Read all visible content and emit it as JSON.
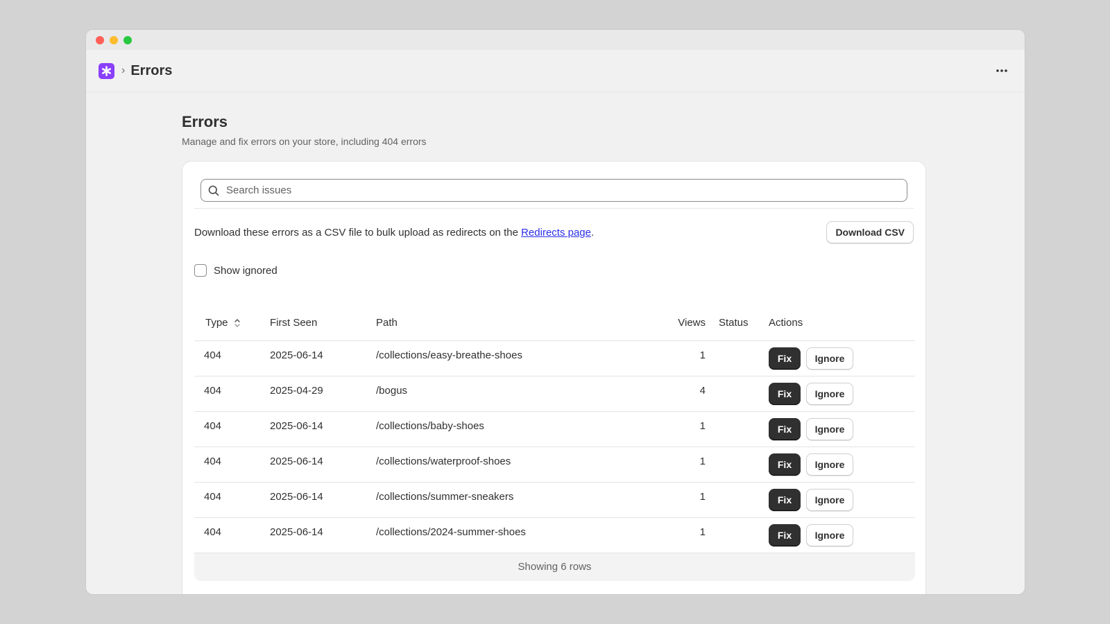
{
  "window": {
    "title": "Errors"
  },
  "appbar": {
    "logo_icon": "asterisk-icon",
    "breadcrumb_separator": "›",
    "title": "Errors",
    "more_icon": "ellipsis-icon"
  },
  "page": {
    "title": "Errors",
    "subtitle": "Manage and fix errors on your store, including 404 errors"
  },
  "search": {
    "placeholder": "Search issues",
    "value": ""
  },
  "download": {
    "text_before": "Download these errors as a CSV file to bulk upload as redirects on the ",
    "link_text": "Redirects page",
    "text_after": ".",
    "button_label": "Download CSV"
  },
  "show_ignored": {
    "label": "Show ignored",
    "checked": false
  },
  "table": {
    "headers": {
      "type": "Type",
      "first_seen": "First Seen",
      "path": "Path",
      "views": "Views",
      "status": "Status",
      "actions": "Actions"
    },
    "fix_label": "Fix",
    "ignore_label": "Ignore",
    "rows": [
      {
        "type": "404",
        "first_seen": "2025-06-14",
        "path": "/collections/easy-breathe-shoes",
        "views": "1",
        "status": ""
      },
      {
        "type": "404",
        "first_seen": "2025-04-29",
        "path": "/bogus",
        "views": "4",
        "status": ""
      },
      {
        "type": "404",
        "first_seen": "2025-06-14",
        "path": "/collections/baby-shoes",
        "views": "1",
        "status": ""
      },
      {
        "type": "404",
        "first_seen": "2025-06-14",
        "path": "/collections/waterproof-shoes",
        "views": "1",
        "status": ""
      },
      {
        "type": "404",
        "first_seen": "2025-06-14",
        "path": "/collections/summer-sneakers",
        "views": "1",
        "status": ""
      },
      {
        "type": "404",
        "first_seen": "2025-06-14",
        "path": "/collections/2024-summer-shoes",
        "views": "1",
        "status": ""
      }
    ],
    "footer": "Showing 6 rows"
  },
  "colors": {
    "brand": "#8a3ffc",
    "primary_button": "#303030",
    "link": "#2a2ee6"
  }
}
